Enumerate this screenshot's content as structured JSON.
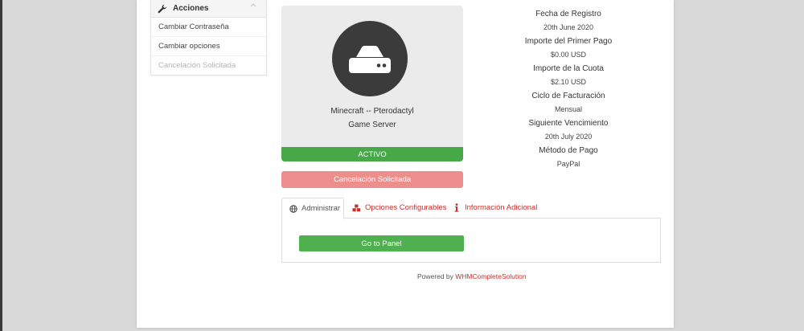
{
  "sidebar": {
    "title": "Acciones",
    "items": [
      {
        "label": "Cambiar Contraseña",
        "disabled": false
      },
      {
        "label": "Cambiar opciones",
        "disabled": false
      },
      {
        "label": "Cancelación Solicitada",
        "disabled": true
      }
    ]
  },
  "product": {
    "icon": "hard-drive-icon",
    "name_line1": "Minecraft -- Pterodactyl",
    "name_line2": "Game Server",
    "status": "ACTIVO",
    "cancel_status": "Cancelación Solicitada"
  },
  "info": [
    {
      "label": "Fecha de Registro",
      "value": "20th June 2020"
    },
    {
      "label": "Importe del Primer Pago",
      "value": "$0.00 USD"
    },
    {
      "label": "Importe de la Cuota",
      "value": "$2.10 USD"
    },
    {
      "label": "Ciclo de Facturación",
      "value": "Mensual"
    },
    {
      "label": "Siguiente Vencimiento",
      "value": "20th July 2020"
    },
    {
      "label": "Método de Pago",
      "value": "PayPal"
    }
  ],
  "tabs": [
    {
      "label": "Administrar",
      "icon": "globe-icon",
      "active": true
    },
    {
      "label": "Opciones Configurables",
      "icon": "cubes-icon",
      "active": false
    },
    {
      "label": "Información Adicional",
      "icon": "info-icon",
      "active": false
    }
  ],
  "panel": {
    "button_label": "Go to Panel"
  },
  "footer": {
    "prefix": "Powered by ",
    "brand": "WHMCompleteSolution"
  },
  "colors": {
    "active": "#46a846",
    "cancel": "#ec8f8c",
    "link": "#c9302c",
    "panel_button": "#4fb04f"
  }
}
